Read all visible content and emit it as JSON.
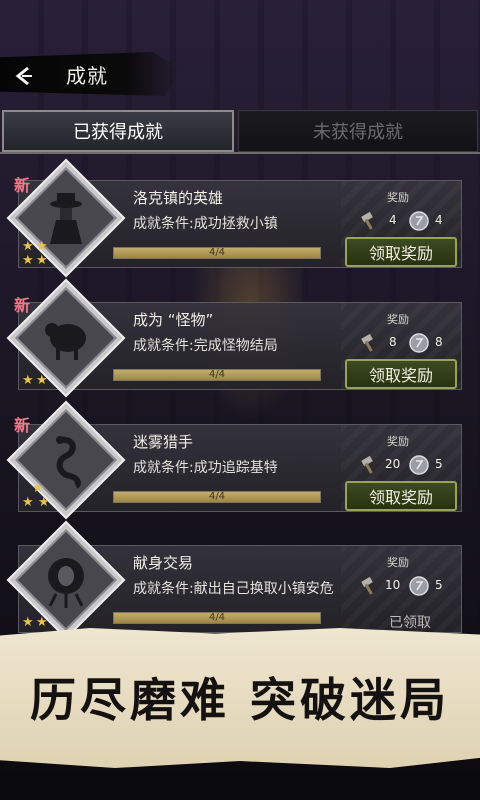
{
  "header": {
    "title": "成就",
    "back_icon": "back-arrow-icon"
  },
  "tabs": [
    {
      "label": "已获得成就",
      "active": true
    },
    {
      "label": "未获得成就",
      "active": false
    }
  ],
  "achievements": [
    {
      "new_tag": "新",
      "name": "洛克镇的英雄",
      "condition": "成就条件:成功拯救小镇",
      "reward_label": "奖励",
      "reward_hammer": "4",
      "reward_coin": "4",
      "progress_text": "4/4",
      "progress": 1.0,
      "stars": 3,
      "action": "领取奖励",
      "icon": "hat-man-icon"
    },
    {
      "new_tag": "新",
      "name": "成为 “怪物”",
      "condition": "成就条件:完成怪物结局",
      "reward_label": "奖励",
      "reward_hammer": "8",
      "reward_coin": "8",
      "progress_text": "4/4",
      "progress": 1.0,
      "stars": 2,
      "action": "领取奖励",
      "icon": "monster-icon"
    },
    {
      "new_tag": "新",
      "name": "迷雾猎手",
      "condition": "成就条件:成功追踪基特",
      "reward_label": "奖励",
      "reward_hammer": "20",
      "reward_coin": "5",
      "progress_text": "4/4",
      "progress": 1.0,
      "stars": 3,
      "action": "领取奖励",
      "icon": "serpent-icon"
    },
    {
      "name": "献身交易",
      "condition": "成就条件:献出自己换取小镇安危",
      "reward_label": "奖励",
      "reward_hammer": "10",
      "reward_coin": "5",
      "progress_text": "4/4",
      "progress": 1.0,
      "stars": 2,
      "status": "已领取",
      "icon": "tree-creature-icon"
    }
  ],
  "banner": {
    "text": "历尽磨难 突破迷局"
  },
  "colors": {
    "star": "#e8c34a",
    "new_tag": "#f07a8a",
    "button_border": "#97a35a"
  }
}
